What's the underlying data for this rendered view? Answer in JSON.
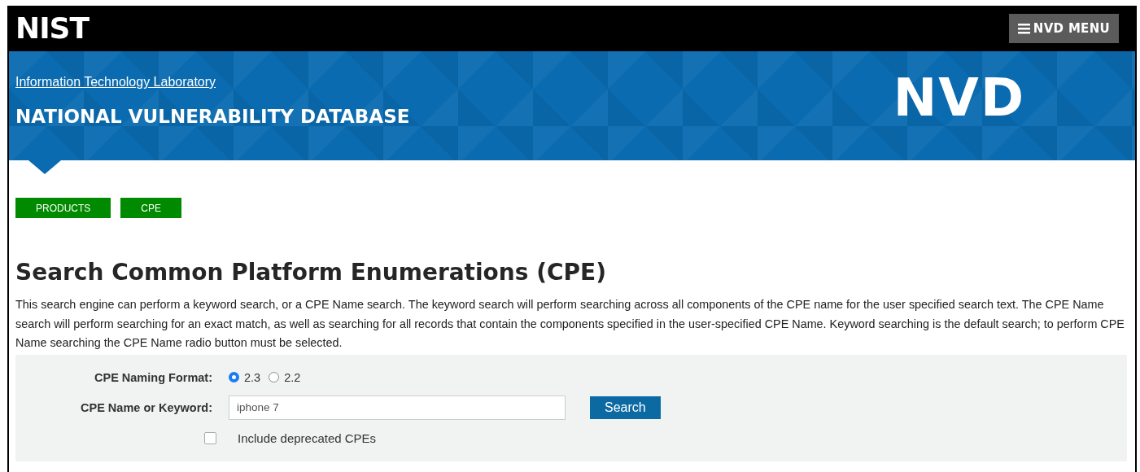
{
  "header": {
    "logo": "NIST",
    "menu_button": "NVD MENU"
  },
  "banner": {
    "link": "Information Technology Laboratory",
    "title": "NATIONAL VULNERABILITY DATABASE",
    "logo": "NVD"
  },
  "breadcrumbs": [
    {
      "label": "PRODUCTS"
    },
    {
      "label": "CPE"
    }
  ],
  "page_title": "Search Common Platform Enumerations (CPE)",
  "description": "This search engine can perform a keyword search, or a CPE Name search. The keyword search will perform searching across all components of the CPE name for the user specified search text. The CPE Name search will perform searching for an exact match, as well as searching for all records that contain the components specified in the user-specified CPE Name. Keyword searching is the default search; to perform CPE Name searching the CPE Name radio button must be selected.",
  "form": {
    "format_label": "CPE Naming Format:",
    "formats": [
      {
        "label": "2.3",
        "selected": true
      },
      {
        "label": "2.2",
        "selected": false
      }
    ],
    "keyword_label": "CPE Name or Keyword:",
    "keyword_value": "iphone 7",
    "search_button": "Search",
    "deprecated": {
      "label": "Include deprecated CPEs",
      "checked": false
    }
  }
}
